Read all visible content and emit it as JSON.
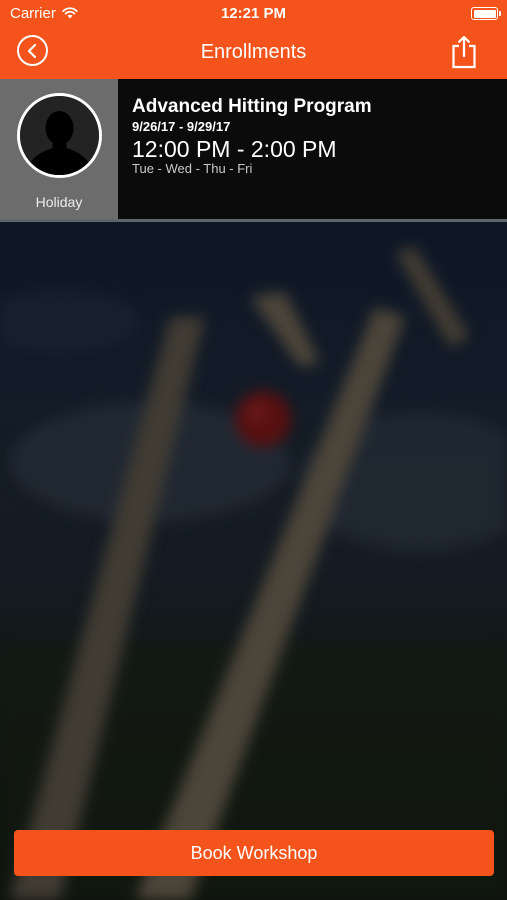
{
  "status_bar": {
    "carrier": "Carrier",
    "time": "12:21 PM",
    "icons": [
      "wifi-icon",
      "battery-icon"
    ]
  },
  "nav_bar": {
    "title": "Enrollments",
    "left_icon": "back-arrow-circle-icon",
    "right_icon": "share-icon"
  },
  "enrollment": {
    "avatar_icon": "person-silhouette-icon",
    "status_label": "Holiday",
    "program_name": "Advanced Hitting Program",
    "date_range": "9/26/17 - 9/29/17",
    "time_range": "12:00 PM - 2:00 PM",
    "days": "Tue - Wed - Thu - Fri"
  },
  "background": {
    "description_icon": "cricket-stumps-photo"
  },
  "actions": {
    "book_label": "Book Workshop"
  },
  "colors": {
    "accent": "#f4541c",
    "card_background": "#0b0b0b",
    "avatar_panel": "#6c6c6c"
  }
}
